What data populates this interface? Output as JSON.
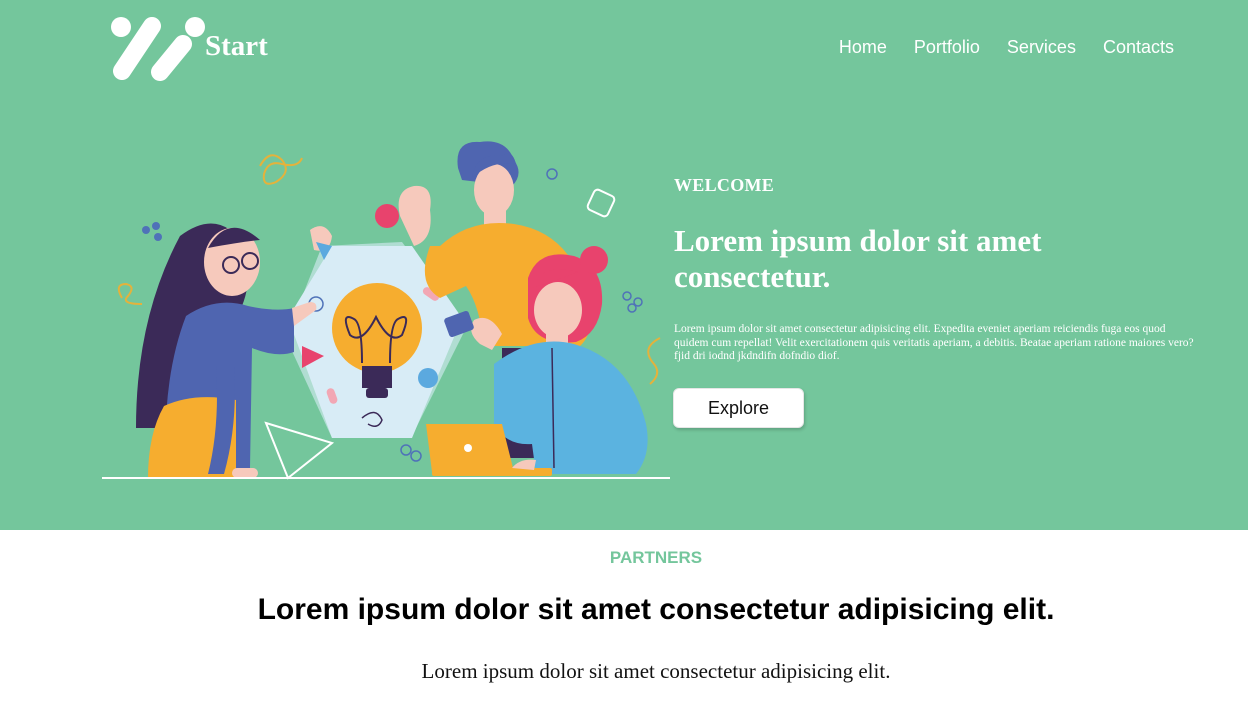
{
  "header": {
    "logo_text": "Start",
    "nav": [
      "Home",
      "Portfolio",
      "Services",
      "Contacts"
    ]
  },
  "hero": {
    "eyebrow": "WELCOME",
    "title": "Lorem ipsum dolor sit amet consectetur.",
    "description": "Lorem ipsum dolor sit amet consectetur adipisicing elit. Expedita eveniet aperiam reiciendis fuga eos quod quidem cum repellat! Velit exercitationem quis veritatis aperiam, a debitis. Beatae aperiam ratione maiores vero? fjid dri iodnd jkdndifn dofndio diof.",
    "button_label": "Explore"
  },
  "partners": {
    "label": "PARTNERS",
    "title": "Lorem ipsum dolor sit amet consectetur adipisicing elit.",
    "subtitle": "Lorem ipsum dolor sit amet consectetur adipisicing elit."
  },
  "colors": {
    "brand_green": "#74c69c",
    "white": "#ffffff",
    "text_dark": "#111111"
  },
  "icons": {
    "logo": "start-logo-icon",
    "illustration": "team-idea-illustration"
  }
}
